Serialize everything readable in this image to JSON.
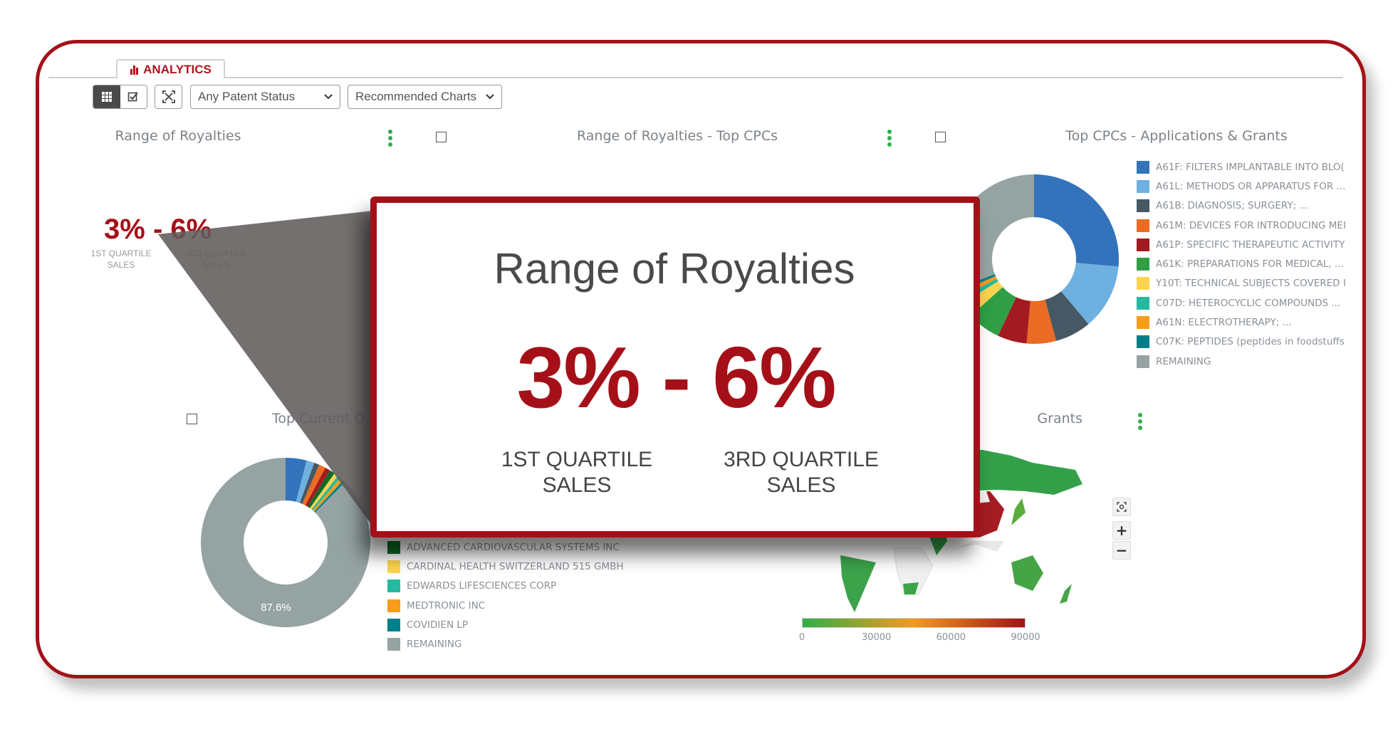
{
  "tab": {
    "label": "ANALYTICS",
    "icon": "bar-chart-icon"
  },
  "toolbar": {
    "grid_view_icon": "grid-icon",
    "select_view_icon": "checkbox-icon",
    "expand_icon": "expand-icon",
    "patent_status": "Any Patent Status",
    "chart_set": "Recommended Charts"
  },
  "colors": {
    "brand_red": "#a51018",
    "menu_dots": "#2fae4a"
  },
  "panels": {
    "royalties": {
      "title": "Range of Royalties",
      "low": "3%",
      "sep": "-",
      "high": "6%",
      "low_label_1": "1ST QUARTILE",
      "low_label_2": "SALES",
      "high_label_1": "3RD QUARTILE",
      "high_label_2": "SALES"
    },
    "royalties_cpc": {
      "title": "Range of Royalties - Top CPCs"
    },
    "top_cpcs": {
      "title": "Top CPCs - Applications & Grants"
    },
    "top_owners": {
      "title": "Top Current O"
    },
    "map": {
      "title": "tions & Grants",
      "scale_ticks": [
        "0",
        "30000",
        "60000",
        "90000"
      ],
      "scale_colors": [
        "#2fae4a",
        "#f49b1a",
        "#a51018"
      ]
    }
  },
  "popup": {
    "title": "Range of Royalties",
    "low": "3%",
    "sep": "-",
    "high": "6%",
    "low_label_1": "1ST QUARTILE",
    "low_label_2": "SALES",
    "high_label_1": "3RD QUARTILE",
    "high_label_2": "SALES"
  },
  "chart_data": [
    {
      "type": "pie",
      "title": "Top CPCs - Applications & Grants",
      "donut": true,
      "legend": "right",
      "slices": [
        {
          "name": "A61F: FILTERS IMPLANTABLE INTO BLO(",
          "value": 26.4,
          "color": "#3273bb"
        },
        {
          "name": "A61L: METHODS OR APPARATUS FOR ...",
          "value": 12.5,
          "color": "#6eb0e0"
        },
        {
          "name": "A61B: DIAGNOSIS; SURGERY; ...",
          "value": 6.9,
          "color": "#465864"
        },
        {
          "name": "A61M: DEVICES FOR INTRODUCING MEI",
          "value": 5.6,
          "color": "#ec6b24"
        },
        {
          "name": "A61P: SPECIFIC THERAPEUTIC ACTIVITY",
          "value": 5.6,
          "color": "#a31b20"
        },
        {
          "name": "A61K: PREPARATIONS FOR MEDICAL, ...",
          "value": 6.4,
          "color": "#2f9e44"
        },
        {
          "name": "Y10T: TECHNICAL SUBJECTS COVERED I",
          "value": 2.8,
          "color": "#fdd34f"
        },
        {
          "name": "C07D: HETEROCYCLIC COMPOUNDS ...",
          "value": 1.1,
          "color": "#25b9a0"
        },
        {
          "name": "A61N: ELECTROTHERAPY; ...",
          "value": 1.1,
          "color": "#f79c1c"
        },
        {
          "name": "C07K: PEPTIDES (peptides in foodstuffs",
          "value": 0.8,
          "color": "#017f8a"
        },
        {
          "name": "REMAINING",
          "value": 30.8,
          "color": "#95a3a3"
        }
      ]
    },
    {
      "type": "pie",
      "title": "Top Current O",
      "donut": true,
      "legend": "right",
      "slices": [
        {
          "value": 4.0,
          "color": "#3273bb"
        },
        {
          "value": 1.5,
          "color": "#6eb0e0"
        },
        {
          "value": 1.0,
          "color": "#465864"
        },
        {
          "value": 1.3,
          "color": "#ec6b24"
        },
        {
          "value": 1.0,
          "color": "#a31b20"
        },
        {
          "name": "ADVANCED CARDIOVASCULAR SYSTEMS INC",
          "value": 1.0,
          "color": "#0e6a25"
        },
        {
          "name": "CARDINAL HEALTH SWITZERLAND 515 GMBH",
          "value": 0.8,
          "color": "#fdd34f"
        },
        {
          "name": "EDWARDS LIFESCIENCES CORP",
          "value": 0.6,
          "color": "#25b9a0"
        },
        {
          "name": "MEDTRONIC INC",
          "value": 0.7,
          "color": "#f79c1c"
        },
        {
          "name": "COVIDIEN LP",
          "value": 0.5,
          "color": "#017f8a"
        },
        {
          "name": "REMAINING",
          "value": 87.6,
          "color": "#95a3a3",
          "label": "87.6%"
        }
      ]
    }
  ]
}
